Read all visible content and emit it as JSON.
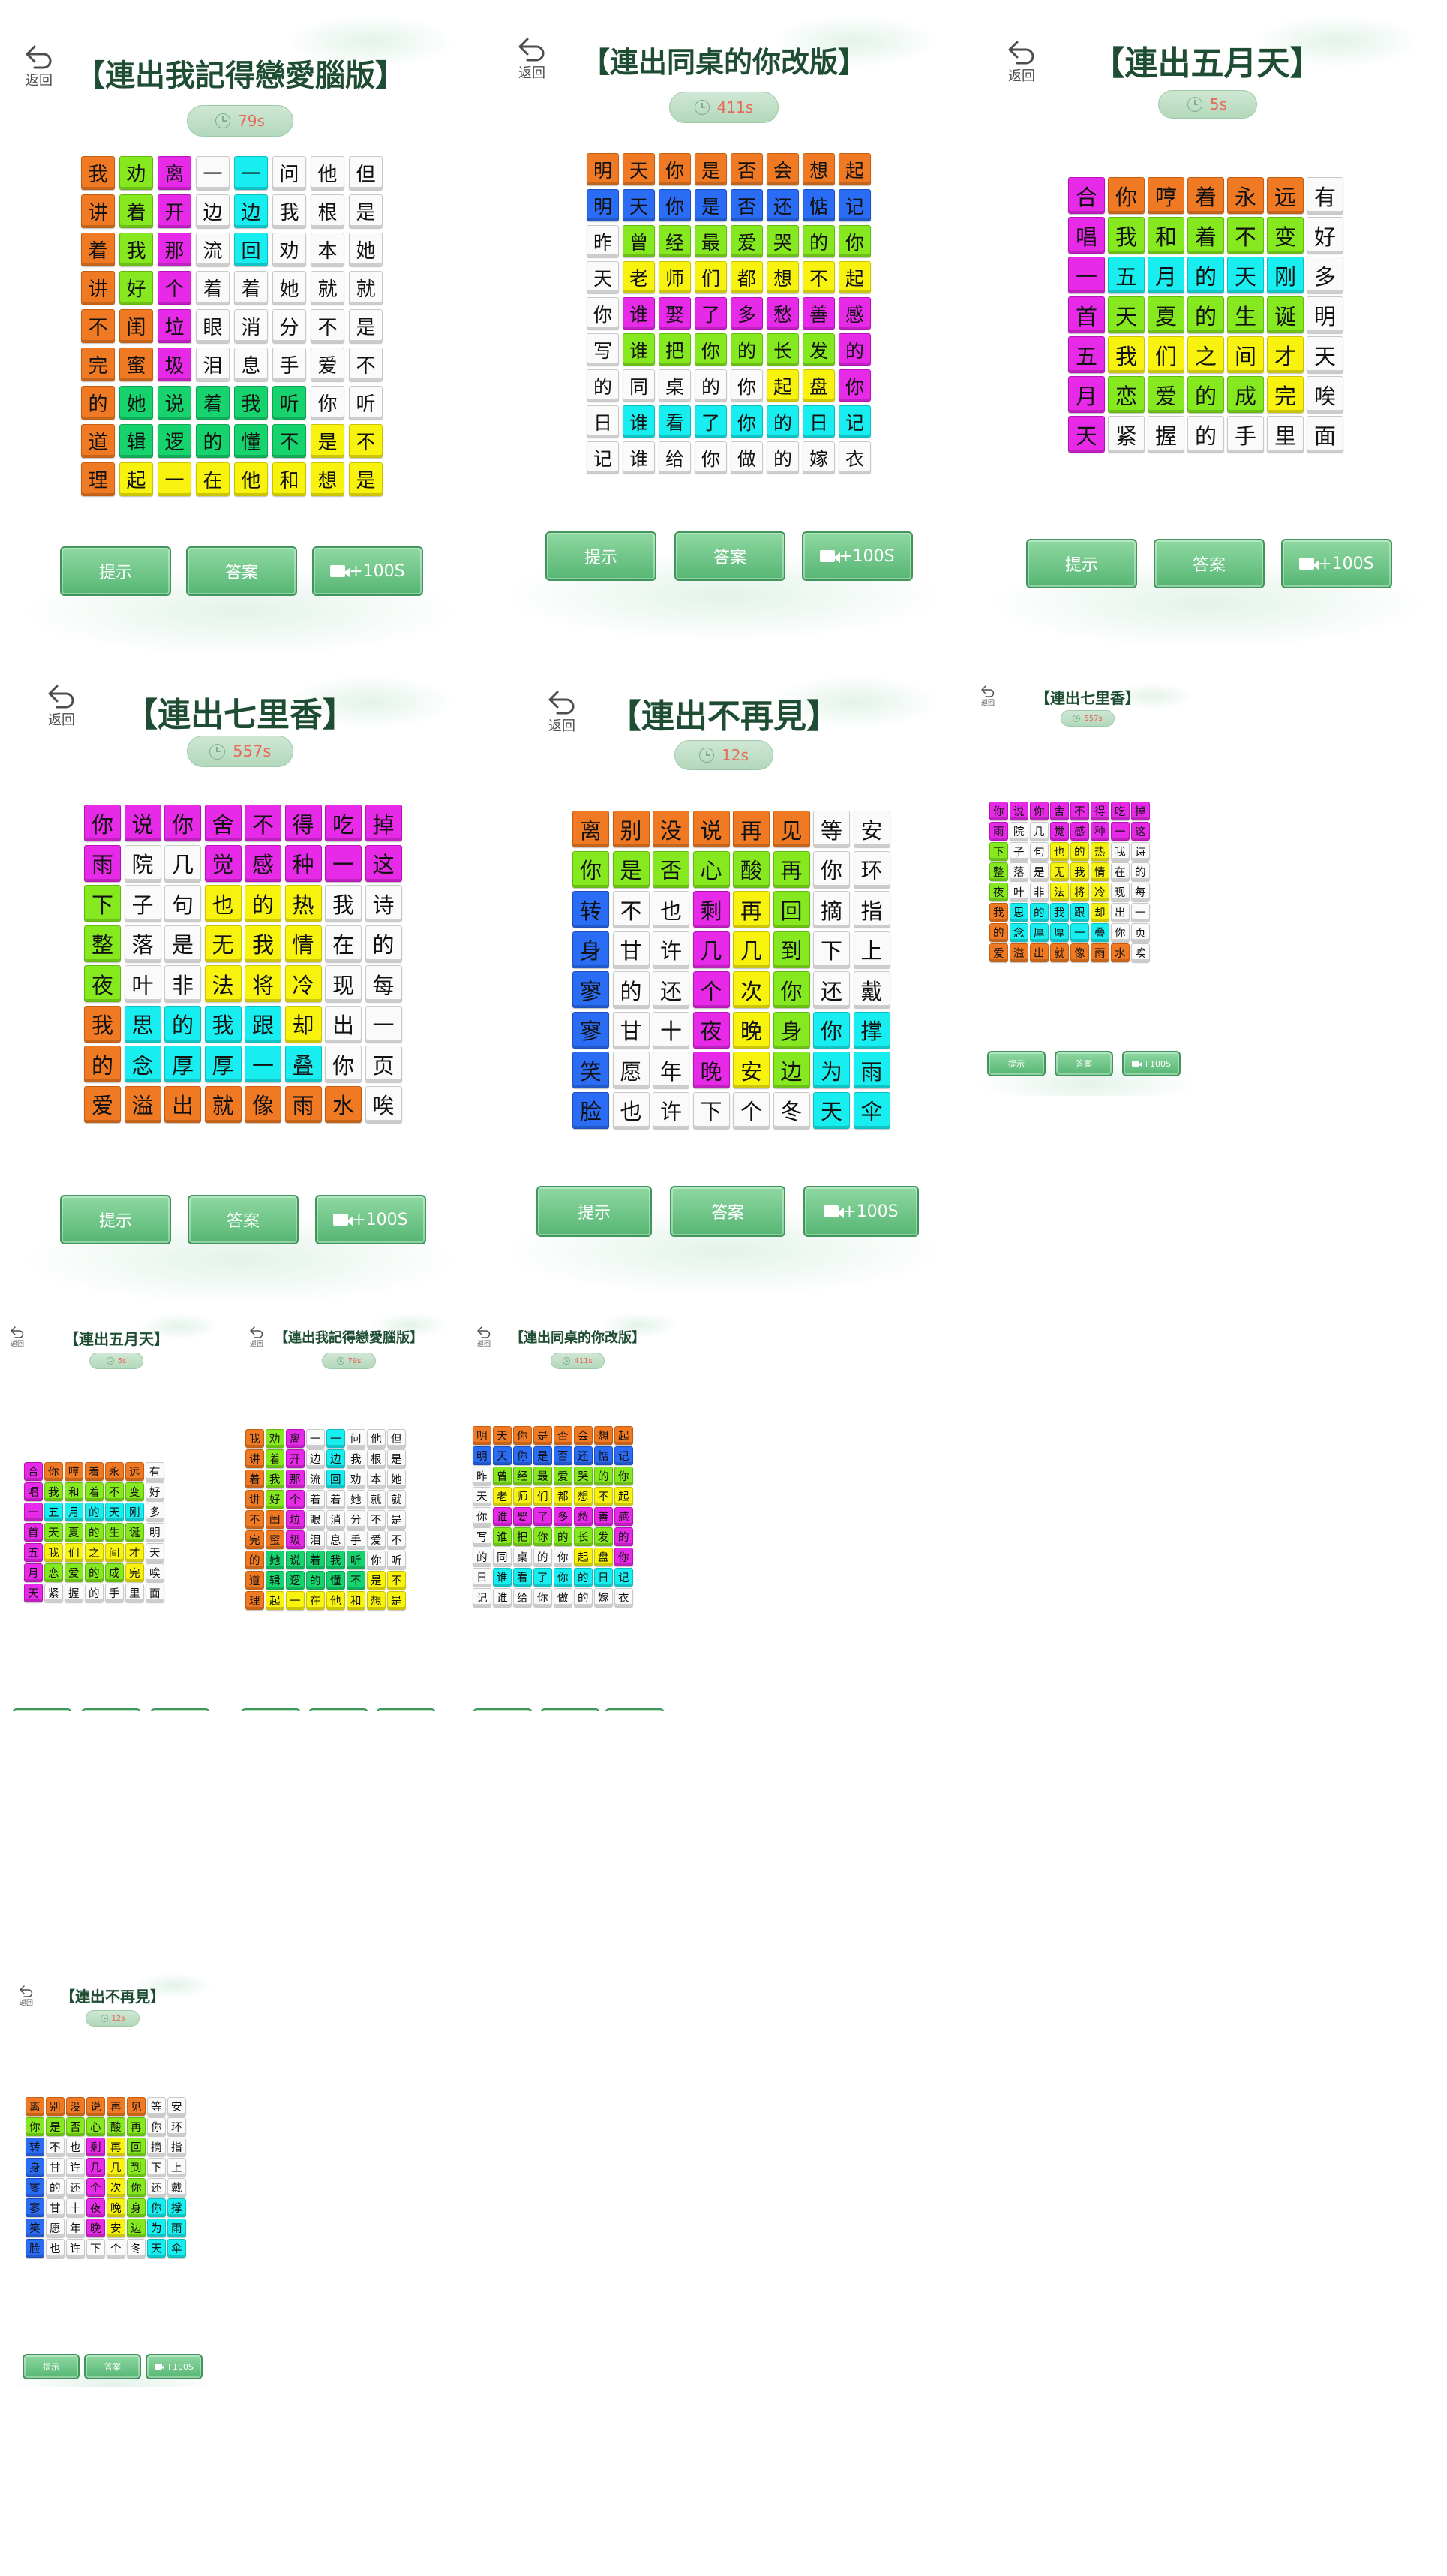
{
  "back_label": "返回",
  "hint_label": "提示",
  "answer_label": "答案",
  "bonus_label": "+100S",
  "colors": {
    "W": "#fafafa",
    "O": "#f07a24",
    "G": "#86e81f",
    "M": "#e72ae7",
    "C": "#18eef0",
    "Y": "#f8f20f",
    "B": "#2b6cf5",
    "N": "#16d36e",
    "title": "#1e4d33",
    "timer_text": "#e8685a",
    "button": "#56b673"
  },
  "puzzles": {
    "love": {
      "title": "【連出我記得戀愛腦版】",
      "timer": "79s",
      "cols": 8,
      "chars": [
        [
          "我",
          "劝",
          "离",
          "一",
          "一",
          "问",
          "他",
          "但"
        ],
        [
          "讲",
          "着",
          "开",
          "边",
          "边",
          "我",
          "根",
          "是"
        ],
        [
          "着",
          "我",
          "那",
          "流",
          "回",
          "劝",
          "本",
          "她"
        ],
        [
          "讲",
          "好",
          "个",
          "着",
          "着",
          "她",
          "就",
          "就"
        ],
        [
          "不",
          "闺",
          "垃",
          "眼",
          "消",
          "分",
          "不",
          "是"
        ],
        [
          "完",
          "蜜",
          "圾",
          "泪",
          "息",
          "手",
          "爱",
          "不"
        ],
        [
          "的",
          "她",
          "说",
          "着",
          "我",
          "听",
          "你",
          "听"
        ],
        [
          "道",
          "辑",
          "逻",
          "的",
          "懂",
          "不",
          "是",
          "不"
        ],
        [
          "理",
          "起",
          "一",
          "在",
          "他",
          "和",
          "想",
          "是"
        ]
      ],
      "colors": [
        [
          "O",
          "G",
          "M",
          "W",
          "C",
          "W",
          "W",
          "W"
        ],
        [
          "O",
          "G",
          "M",
          "W",
          "C",
          "W",
          "W",
          "W"
        ],
        [
          "O",
          "G",
          "M",
          "W",
          "C",
          "W",
          "W",
          "W"
        ],
        [
          "O",
          "G",
          "M",
          "W",
          "W",
          "W",
          "W",
          "W"
        ],
        [
          "O",
          "O",
          "M",
          "W",
          "W",
          "W",
          "W",
          "W"
        ],
        [
          "O",
          "O",
          "M",
          "W",
          "W",
          "W",
          "W",
          "W"
        ],
        [
          "O",
          "N",
          "N",
          "N",
          "N",
          "N",
          "W",
          "W"
        ],
        [
          "O",
          "N",
          "N",
          "N",
          "N",
          "N",
          "Y",
          "Y"
        ],
        [
          "O",
          "Y",
          "Y",
          "Y",
          "Y",
          "Y",
          "Y",
          "Y"
        ]
      ]
    },
    "deskmate": {
      "title": "【連出同桌的你改版】",
      "timer": "411s",
      "cols": 8,
      "chars": [
        [
          "明",
          "天",
          "你",
          "是",
          "否",
          "会",
          "想",
          "起"
        ],
        [
          "明",
          "天",
          "你",
          "是",
          "否",
          "还",
          "惦",
          "记"
        ],
        [
          "昨",
          "曾",
          "经",
          "最",
          "爱",
          "哭",
          "的",
          "你"
        ],
        [
          "天",
          "老",
          "师",
          "们",
          "都",
          "想",
          "不",
          "起"
        ],
        [
          "你",
          "谁",
          "娶",
          "了",
          "多",
          "愁",
          "善",
          "感"
        ],
        [
          "写",
          "谁",
          "把",
          "你",
          "的",
          "长",
          "发",
          "的"
        ],
        [
          "的",
          "同",
          "桌",
          "的",
          "你",
          "起",
          "盘",
          "你"
        ],
        [
          "日",
          "谁",
          "看",
          "了",
          "你",
          "的",
          "日",
          "记"
        ],
        [
          "记",
          "谁",
          "给",
          "你",
          "做",
          "的",
          "嫁",
          "衣"
        ]
      ],
      "colors": [
        [
          "O",
          "O",
          "O",
          "O",
          "O",
          "O",
          "O",
          "O"
        ],
        [
          "B",
          "B",
          "B",
          "B",
          "B",
          "B",
          "B",
          "B"
        ],
        [
          "W",
          "G",
          "G",
          "G",
          "G",
          "G",
          "G",
          "G"
        ],
        [
          "W",
          "Y",
          "Y",
          "Y",
          "Y",
          "Y",
          "Y",
          "Y"
        ],
        [
          "W",
          "M",
          "M",
          "M",
          "M",
          "M",
          "M",
          "M"
        ],
        [
          "W",
          "G",
          "G",
          "G",
          "G",
          "G",
          "G",
          "M"
        ],
        [
          "W",
          "W",
          "W",
          "W",
          "W",
          "Y",
          "Y",
          "M"
        ],
        [
          "W",
          "C",
          "C",
          "C",
          "C",
          "C",
          "C",
          "C"
        ],
        [
          "W",
          "W",
          "W",
          "W",
          "W",
          "W",
          "W",
          "W"
        ]
      ]
    },
    "mayday": {
      "title": "【連出五月天】",
      "timer": "5s",
      "cols": 7,
      "chars": [
        [
          "合",
          "你",
          "哼",
          "着",
          "永",
          "远",
          "有"
        ],
        [
          "唱",
          "我",
          "和",
          "着",
          "不",
          "变",
          "好"
        ],
        [
          "一",
          "五",
          "月",
          "的",
          "天",
          "刚",
          "多"
        ],
        [
          "首",
          "天",
          "夏",
          "的",
          "生",
          "诞",
          "明"
        ],
        [
          "五",
          "我",
          "们",
          "之",
          "间",
          "才",
          "天"
        ],
        [
          "月",
          "恋",
          "爱",
          "的",
          "成",
          "完",
          "唉"
        ],
        [
          "天",
          "紧",
          "握",
          "的",
          "手",
          "里",
          "面"
        ]
      ],
      "colors": [
        [
          "M",
          "O",
          "O",
          "O",
          "O",
          "O",
          "W"
        ],
        [
          "M",
          "G",
          "G",
          "G",
          "G",
          "G",
          "W"
        ],
        [
          "M",
          "C",
          "C",
          "C",
          "C",
          "C",
          "W"
        ],
        [
          "M",
          "G",
          "G",
          "G",
          "G",
          "G",
          "W"
        ],
        [
          "M",
          "Y",
          "Y",
          "Y",
          "Y",
          "Y",
          "W"
        ],
        [
          "M",
          "G",
          "G",
          "G",
          "G",
          "Y",
          "W"
        ],
        [
          "M",
          "W",
          "W",
          "W",
          "W",
          "W",
          "W"
        ]
      ]
    },
    "qilixiang": {
      "title": "【連出七里香】",
      "timer": "557s",
      "cols": 8,
      "chars": [
        [
          "你",
          "说",
          "你",
          "舍",
          "不",
          "得",
          "吃",
          "掉"
        ],
        [
          "雨",
          "院",
          "几",
          "觉",
          "感",
          "种",
          "一",
          "这"
        ],
        [
          "下",
          "子",
          "句",
          "也",
          "的",
          "热",
          "我",
          "诗"
        ],
        [
          "整",
          "落",
          "是",
          "无",
          "我",
          "情",
          "在",
          "的"
        ],
        [
          "夜",
          "叶",
          "非",
          "法",
          "将",
          "冷",
          "现",
          "每"
        ],
        [
          "我",
          "思",
          "的",
          "我",
          "跟",
          "却",
          "出",
          "一"
        ],
        [
          "的",
          "念",
          "厚",
          "厚",
          "一",
          "叠",
          "你",
          "页"
        ],
        [
          "爱",
          "溢",
          "出",
          "就",
          "像",
          "雨",
          "水",
          "唉"
        ]
      ],
      "colors": [
        [
          "M",
          "M",
          "M",
          "M",
          "M",
          "M",
          "M",
          "M"
        ],
        [
          "M",
          "W",
          "W",
          "M",
          "M",
          "M",
          "M",
          "M"
        ],
        [
          "G",
          "W",
          "W",
          "Y",
          "Y",
          "Y",
          "W",
          "W"
        ],
        [
          "G",
          "W",
          "W",
          "Y",
          "Y",
          "Y",
          "W",
          "W"
        ],
        [
          "G",
          "W",
          "W",
          "Y",
          "Y",
          "Y",
          "W",
          "W"
        ],
        [
          "O",
          "C",
          "C",
          "C",
          "C",
          "Y",
          "W",
          "W"
        ],
        [
          "O",
          "C",
          "C",
          "C",
          "C",
          "C",
          "W",
          "W"
        ],
        [
          "O",
          "O",
          "O",
          "O",
          "O",
          "O",
          "O",
          "W"
        ]
      ]
    },
    "neverseen": {
      "title": "【連出不再見】",
      "timer": "12s",
      "cols": 8,
      "chars": [
        [
          "离",
          "别",
          "没",
          "说",
          "再",
          "见",
          "等",
          "安"
        ],
        [
          "你",
          "是",
          "否",
          "心",
          "酸",
          "再",
          "你",
          "环"
        ],
        [
          "转",
          "不",
          "也",
          "剩",
          "再",
          "回",
          "摘",
          "指"
        ],
        [
          "身",
          "甘",
          "许",
          "几",
          "几",
          "到",
          "下",
          "上"
        ],
        [
          "寥",
          "的",
          "还",
          "个",
          "次",
          "你",
          "还",
          "戴"
        ],
        [
          "寥",
          "甘",
          "十",
          "夜",
          "晚",
          "身",
          "你",
          "撑"
        ],
        [
          "笑",
          "愿",
          "年",
          "晚",
          "安",
          "边",
          "为",
          "雨"
        ],
        [
          "脸",
          "也",
          "许",
          "下",
          "个",
          "冬",
          "天",
          "伞"
        ]
      ],
      "colors": [
        [
          "O",
          "O",
          "O",
          "O",
          "O",
          "O",
          "W",
          "W"
        ],
        [
          "G",
          "G",
          "G",
          "G",
          "G",
          "G",
          "W",
          "W"
        ],
        [
          "B",
          "W",
          "W",
          "M",
          "Y",
          "G",
          "W",
          "W"
        ],
        [
          "B",
          "W",
          "W",
          "M",
          "Y",
          "G",
          "W",
          "W"
        ],
        [
          "B",
          "W",
          "W",
          "M",
          "Y",
          "G",
          "W",
          "W"
        ],
        [
          "B",
          "W",
          "W",
          "M",
          "Y",
          "G",
          "C",
          "C"
        ],
        [
          "B",
          "W",
          "W",
          "M",
          "Y",
          "G",
          "C",
          "C"
        ],
        [
          "B",
          "W",
          "W",
          "W",
          "W",
          "W",
          "C",
          "C"
        ]
      ]
    }
  },
  "panels": [
    {
      "id": "p1",
      "puzzle": "love"
    },
    {
      "id": "p2",
      "puzzle": "deskmate"
    },
    {
      "id": "p3",
      "puzzle": "mayday"
    },
    {
      "id": "p4",
      "puzzle": "qilixiang"
    },
    {
      "id": "p5",
      "puzzle": "neverseen"
    },
    {
      "id": "p6",
      "puzzle": "qilixiang"
    },
    {
      "id": "p7",
      "puzzle": "mayday"
    },
    {
      "id": "p8",
      "puzzle": "love"
    },
    {
      "id": "p9",
      "puzzle": "deskmate"
    },
    {
      "id": "p10",
      "puzzle": "neverseen"
    }
  ]
}
